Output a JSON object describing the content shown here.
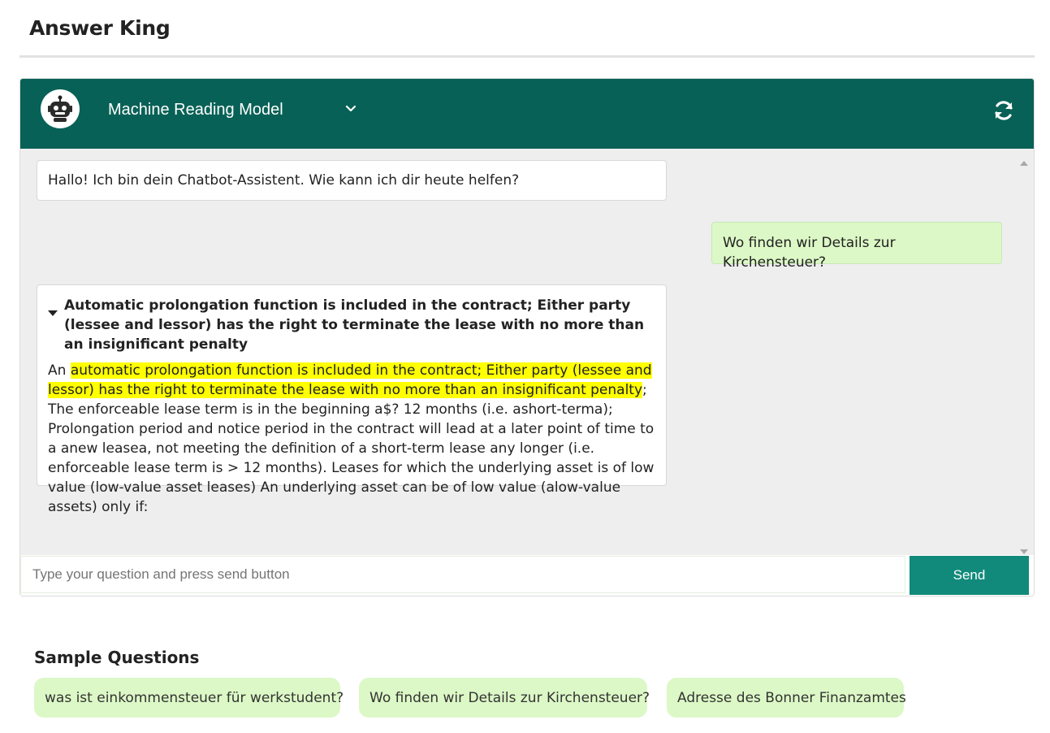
{
  "app": {
    "title": "Answer King"
  },
  "chat": {
    "header": {
      "model_label": "Machine Reading Model",
      "avatar_icon": "robot-icon",
      "dropdown_icon": "chevron-down-icon",
      "refresh_icon": "refresh-icon",
      "background_color": "#086156"
    },
    "messages": [
      {
        "role": "bot",
        "text": "Hallo! Ich bin dein Chatbot-Assistent. Wie kann ich dir heute helfen?"
      },
      {
        "role": "user",
        "text": "Wo finden wir Details zur Kirchensteuer?"
      },
      {
        "role": "bot",
        "summary": "Automatic prolongation function is included in the contract; Either party (lessee and lessor) has the right to terminate the lease with no more than an insignificant penalty",
        "body_prefix": "An ",
        "body_highlight": "automatic prolongation function is included in the contract; Either party (lessee and lessor) has the right to terminate the lease with no more than an insignificant penalty",
        "body_suffix": "; The enforceable lease term is in the beginning a$? 12 months (i.e. ashort-terma); Prolongation period and notice period in the contract will lead at a later point of time to a anew leasea, not meeting the definition of a short-term lease any longer (i.e. enforceable lease term is > 12 months). Leases for which the underlying asset is of low value (low-value asset leases) An underlying asset can be of low value (alow-value assets) only if:",
        "highlight_color": "#ffff00"
      }
    ],
    "input": {
      "placeholder": "Type your question and press send button",
      "value": ""
    },
    "send_label": "Send",
    "accent_color": "#118a7b",
    "user_bubble_color": "#dcf8c6"
  },
  "samples": {
    "title": "Sample Questions",
    "items": [
      "was ist einkommensteuer für werkstudent?",
      "Wo finden wir Details zur Kirchensteuer?",
      "Adresse des Bonner Finanzamtes"
    ]
  }
}
